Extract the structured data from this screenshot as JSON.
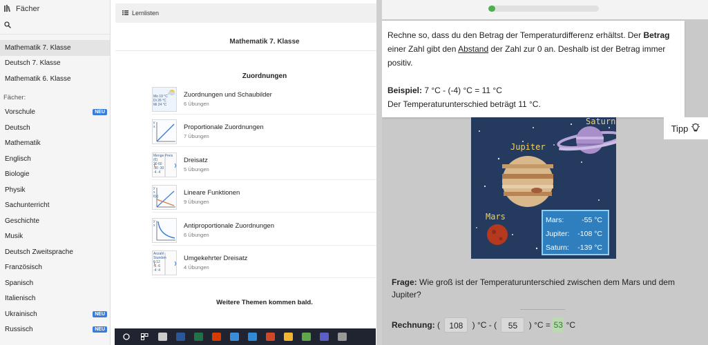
{
  "left_panel": {
    "header_label": "Fächer",
    "recent_items": [
      {
        "label": "Mathematik 7. Klasse",
        "selected": true
      },
      {
        "label": "Deutsch 7. Klasse",
        "selected": false
      },
      {
        "label": "Mathematik 6. Klasse",
        "selected": false
      }
    ],
    "section_label": "Fächer:",
    "subjects": [
      {
        "label": "Vorschule",
        "badge": "NEU"
      },
      {
        "label": "Deutsch",
        "badge": ""
      },
      {
        "label": "Mathematik",
        "badge": ""
      },
      {
        "label": "Englisch",
        "badge": ""
      },
      {
        "label": "Biologie",
        "badge": ""
      },
      {
        "label": "Physik",
        "badge": ""
      },
      {
        "label": "Sachunterricht",
        "badge": ""
      },
      {
        "label": "Geschichte",
        "badge": ""
      },
      {
        "label": "Musik",
        "badge": ""
      },
      {
        "label": "Deutsch Zweitsprache",
        "badge": ""
      },
      {
        "label": "Französisch",
        "badge": ""
      },
      {
        "label": "Spanisch",
        "badge": ""
      },
      {
        "label": "Italienisch",
        "badge": ""
      },
      {
        "label": "Ukrainisch",
        "badge": "NEU"
      },
      {
        "label": "Russisch",
        "badge": "NEU"
      }
    ]
  },
  "middle_panel": {
    "toolbar_label": "Lernlisten",
    "title": "Mathematik 7. Klasse",
    "section_title": "Zuordnungen",
    "topics": [
      {
        "title": "Zuordnungen und Schaubilder",
        "sub": "6 Übungen",
        "thumb_lines": [
          "Mo 19 °C",
          "Di 26 °C",
          "Mi 24 °C"
        ]
      },
      {
        "title": "Proportionale Zuordnungen",
        "sub": "7 Übungen",
        "thumb_lines": [
          "y",
          "x"
        ]
      },
      {
        "title": "Dreisatz",
        "sub": "5 Übungen",
        "thumb_lines": [
          "Menge Preis (€)",
          "30 60",
          ":30 :30",
          "·4 ·4"
        ]
      },
      {
        "title": "Lineare Funktionen",
        "sub": "9 Übungen",
        "thumb_lines": [
          "y",
          "x",
          "f(x)"
        ]
      },
      {
        "title": "Antiproportionale Zuordnungen",
        "sub": "6 Übungen",
        "thumb_lines": [
          "y",
          "x"
        ]
      },
      {
        "title": "Umgekehrter Dreisatz",
        "sub": "4 Übungen",
        "thumb_lines": [
          "Anzahl Stunden",
          "6 12",
          ":6 ·6",
          "·4 :4"
        ]
      }
    ],
    "footer_text": "Weitere Themen kommen bald."
  },
  "taskbar": {
    "icons": [
      "start-icon",
      "search-icon",
      "task-view-icon",
      "word-icon",
      "excel-icon",
      "office-icon",
      "mail-icon",
      "edge-icon",
      "powerpoint-icon",
      "files-icon",
      "store-icon",
      "teams-icon",
      "app-icon"
    ],
    "colors": [
      "#ffffff",
      "#ffffff",
      "#cccccc",
      "#2b579a",
      "#217346",
      "#d83b01",
      "#3a8fd8",
      "#2f8bd8",
      "#d24726",
      "#f2b632",
      "#5ea74a",
      "#5b5fc7",
      "#999999"
    ]
  },
  "right_panel": {
    "progress": 0.06,
    "progress_color": "#4caf50",
    "hint": {
      "p1_a": "Rechne so, dass du den Betrag der Temperaturdifferenz erhältst. Der ",
      "p1_bold": "Betrag",
      "p1_b": " einer Zahl gibt den ",
      "p1_underline": "Abstand",
      "p1_c": " der Zahl zur 0 an. Deshalb ist der Betrag immer positiv.",
      "example_label": "Beispiel:",
      "example_text": " 7 °C - (-4) °C = 11 °C",
      "example_result": "Der Temperaturunterschied beträgt 11 °C."
    },
    "tipp_label": "Tipp",
    "image": {
      "saturn_label": "Saturn",
      "jupiter_label": "Jupiter",
      "mars_label": "Mars",
      "temps": [
        {
          "planet": "Mars:",
          "value": "-55 °C"
        },
        {
          "planet": "Jupiter:",
          "value": "-108 °C"
        },
        {
          "planet": "Saturn:",
          "value": "-139 °C"
        }
      ]
    },
    "question_label": "Frage:",
    "question_text": " Wie groß ist der Temperaturunterschied zwischen dem Mars und dem Jupiter?",
    "calc": {
      "label": "Rechnung:",
      "open1": " ( ",
      "value1": "108",
      "mid": " ) °C - ( ",
      "value2": "55",
      "close": " ) °C = ",
      "answer": "53",
      "unit": " °C"
    }
  }
}
